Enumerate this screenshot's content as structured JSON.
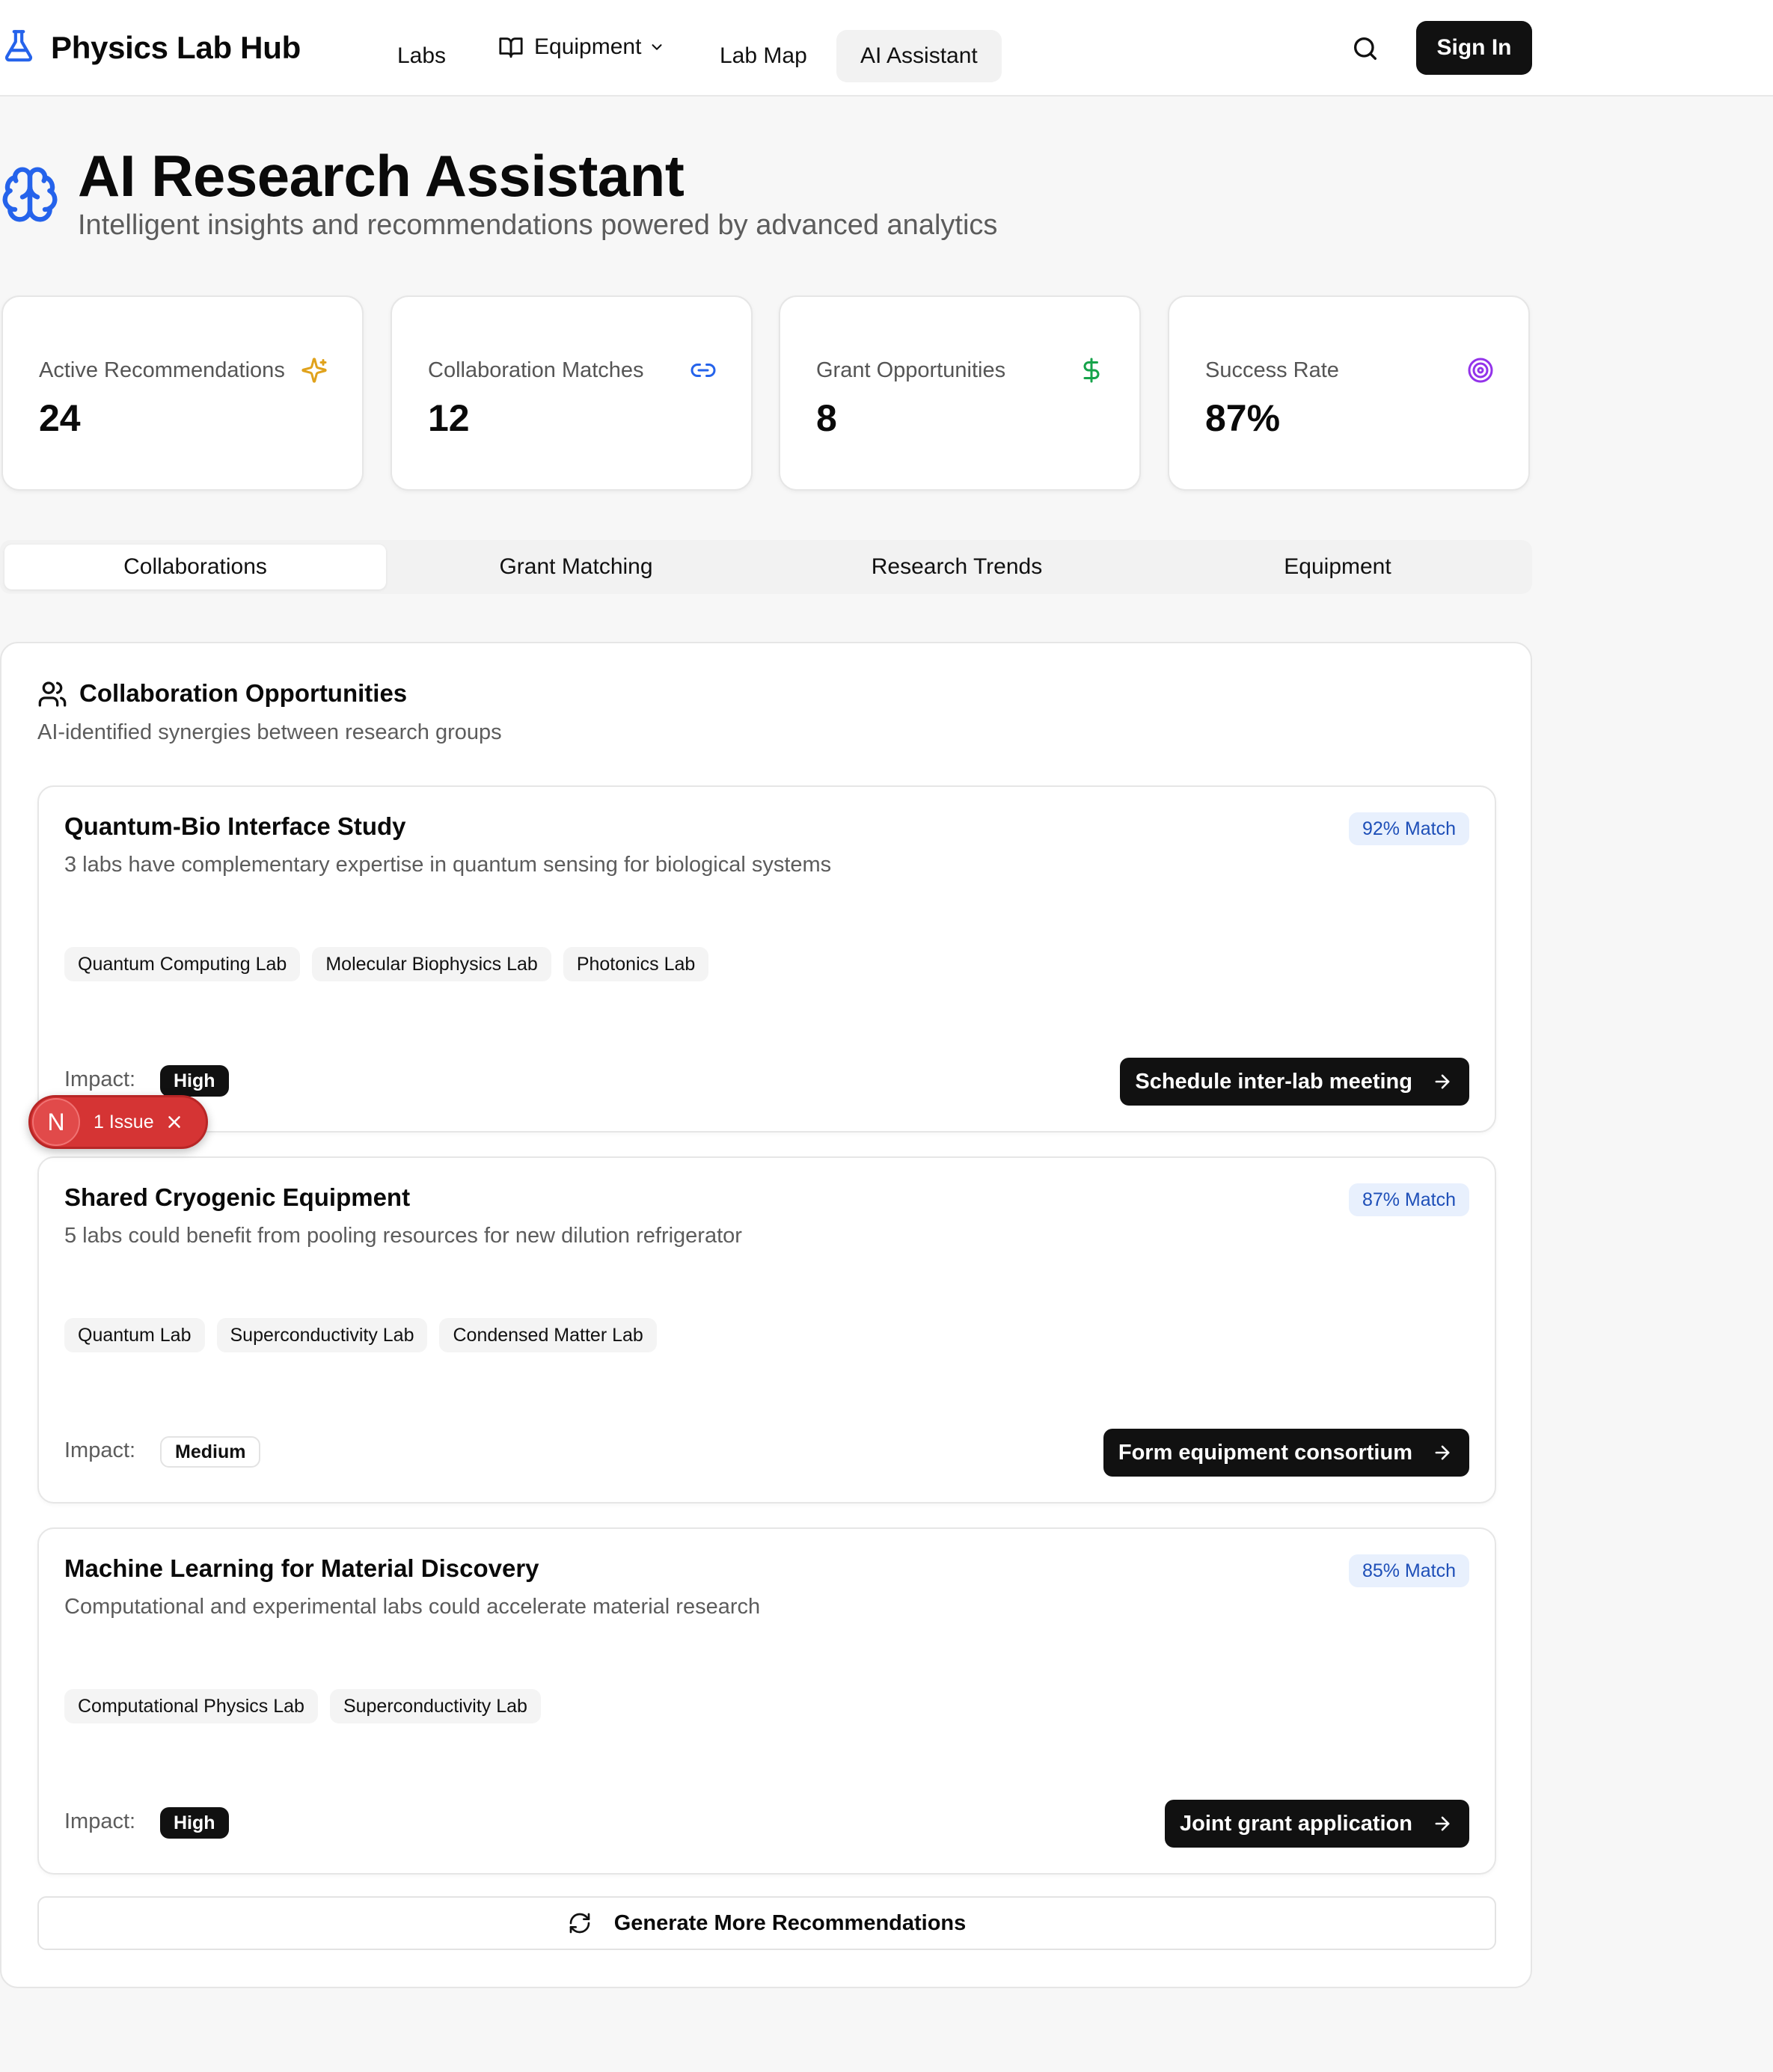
{
  "header": {
    "brand": "Physics Lab Hub",
    "nav": [
      {
        "label": "Labs"
      },
      {
        "label": "Equipment"
      },
      {
        "label": "Lab Map"
      },
      {
        "label": "AI Assistant"
      }
    ],
    "sign_in": "Sign In"
  },
  "page": {
    "title": "AI Research Assistant",
    "subtitle": "Intelligent insights and recommendations powered by advanced analytics"
  },
  "stats": [
    {
      "label": "Active Recommendations",
      "value": "24",
      "icon": "sparkles-icon",
      "color": "#e0a21b"
    },
    {
      "label": "Collaboration Matches",
      "value": "12",
      "icon": "link-icon",
      "color": "#2563eb"
    },
    {
      "label": "Grant Opportunities",
      "value": "8",
      "icon": "dollar-icon",
      "color": "#16a34a"
    },
    {
      "label": "Success Rate",
      "value": "87%",
      "icon": "target-icon",
      "color": "#9333ea"
    }
  ],
  "tabs": [
    {
      "label": "Collaborations",
      "active": true
    },
    {
      "label": "Grant Matching",
      "active": false
    },
    {
      "label": "Research Trends",
      "active": false
    },
    {
      "label": "Equipment",
      "active": false
    }
  ],
  "panel": {
    "title": "Collaboration Opportunities",
    "subtitle": "AI-identified synergies between research groups",
    "impact_label": "Impact:",
    "opportunities": [
      {
        "title": "Quantum-Bio Interface Study",
        "description": "3 labs have complementary expertise in quantum sensing for biological systems",
        "match": "92% Match",
        "labs": [
          "Quantum Computing Lab",
          "Molecular Biophysics Lab",
          "Photonics Lab"
        ],
        "impact": "High",
        "action": "Schedule inter-lab meeting"
      },
      {
        "title": "Shared Cryogenic Equipment",
        "description": "5 labs could benefit from pooling resources for new dilution refrigerator",
        "match": "87% Match",
        "labs": [
          "Quantum Lab",
          "Superconductivity Lab",
          "Condensed Matter Lab"
        ],
        "impact": "Medium",
        "action": "Form equipment consortium"
      },
      {
        "title": "Machine Learning for Material Discovery",
        "description": "Computational and experimental labs could accelerate material research",
        "match": "85% Match",
        "labs": [
          "Computational Physics Lab",
          "Superconductivity Lab"
        ],
        "impact": "High",
        "action": "Joint grant application"
      }
    ],
    "generate_label": "Generate More Recommendations"
  },
  "issue_toast": {
    "avatar": "N",
    "text": "1 Issue"
  }
}
